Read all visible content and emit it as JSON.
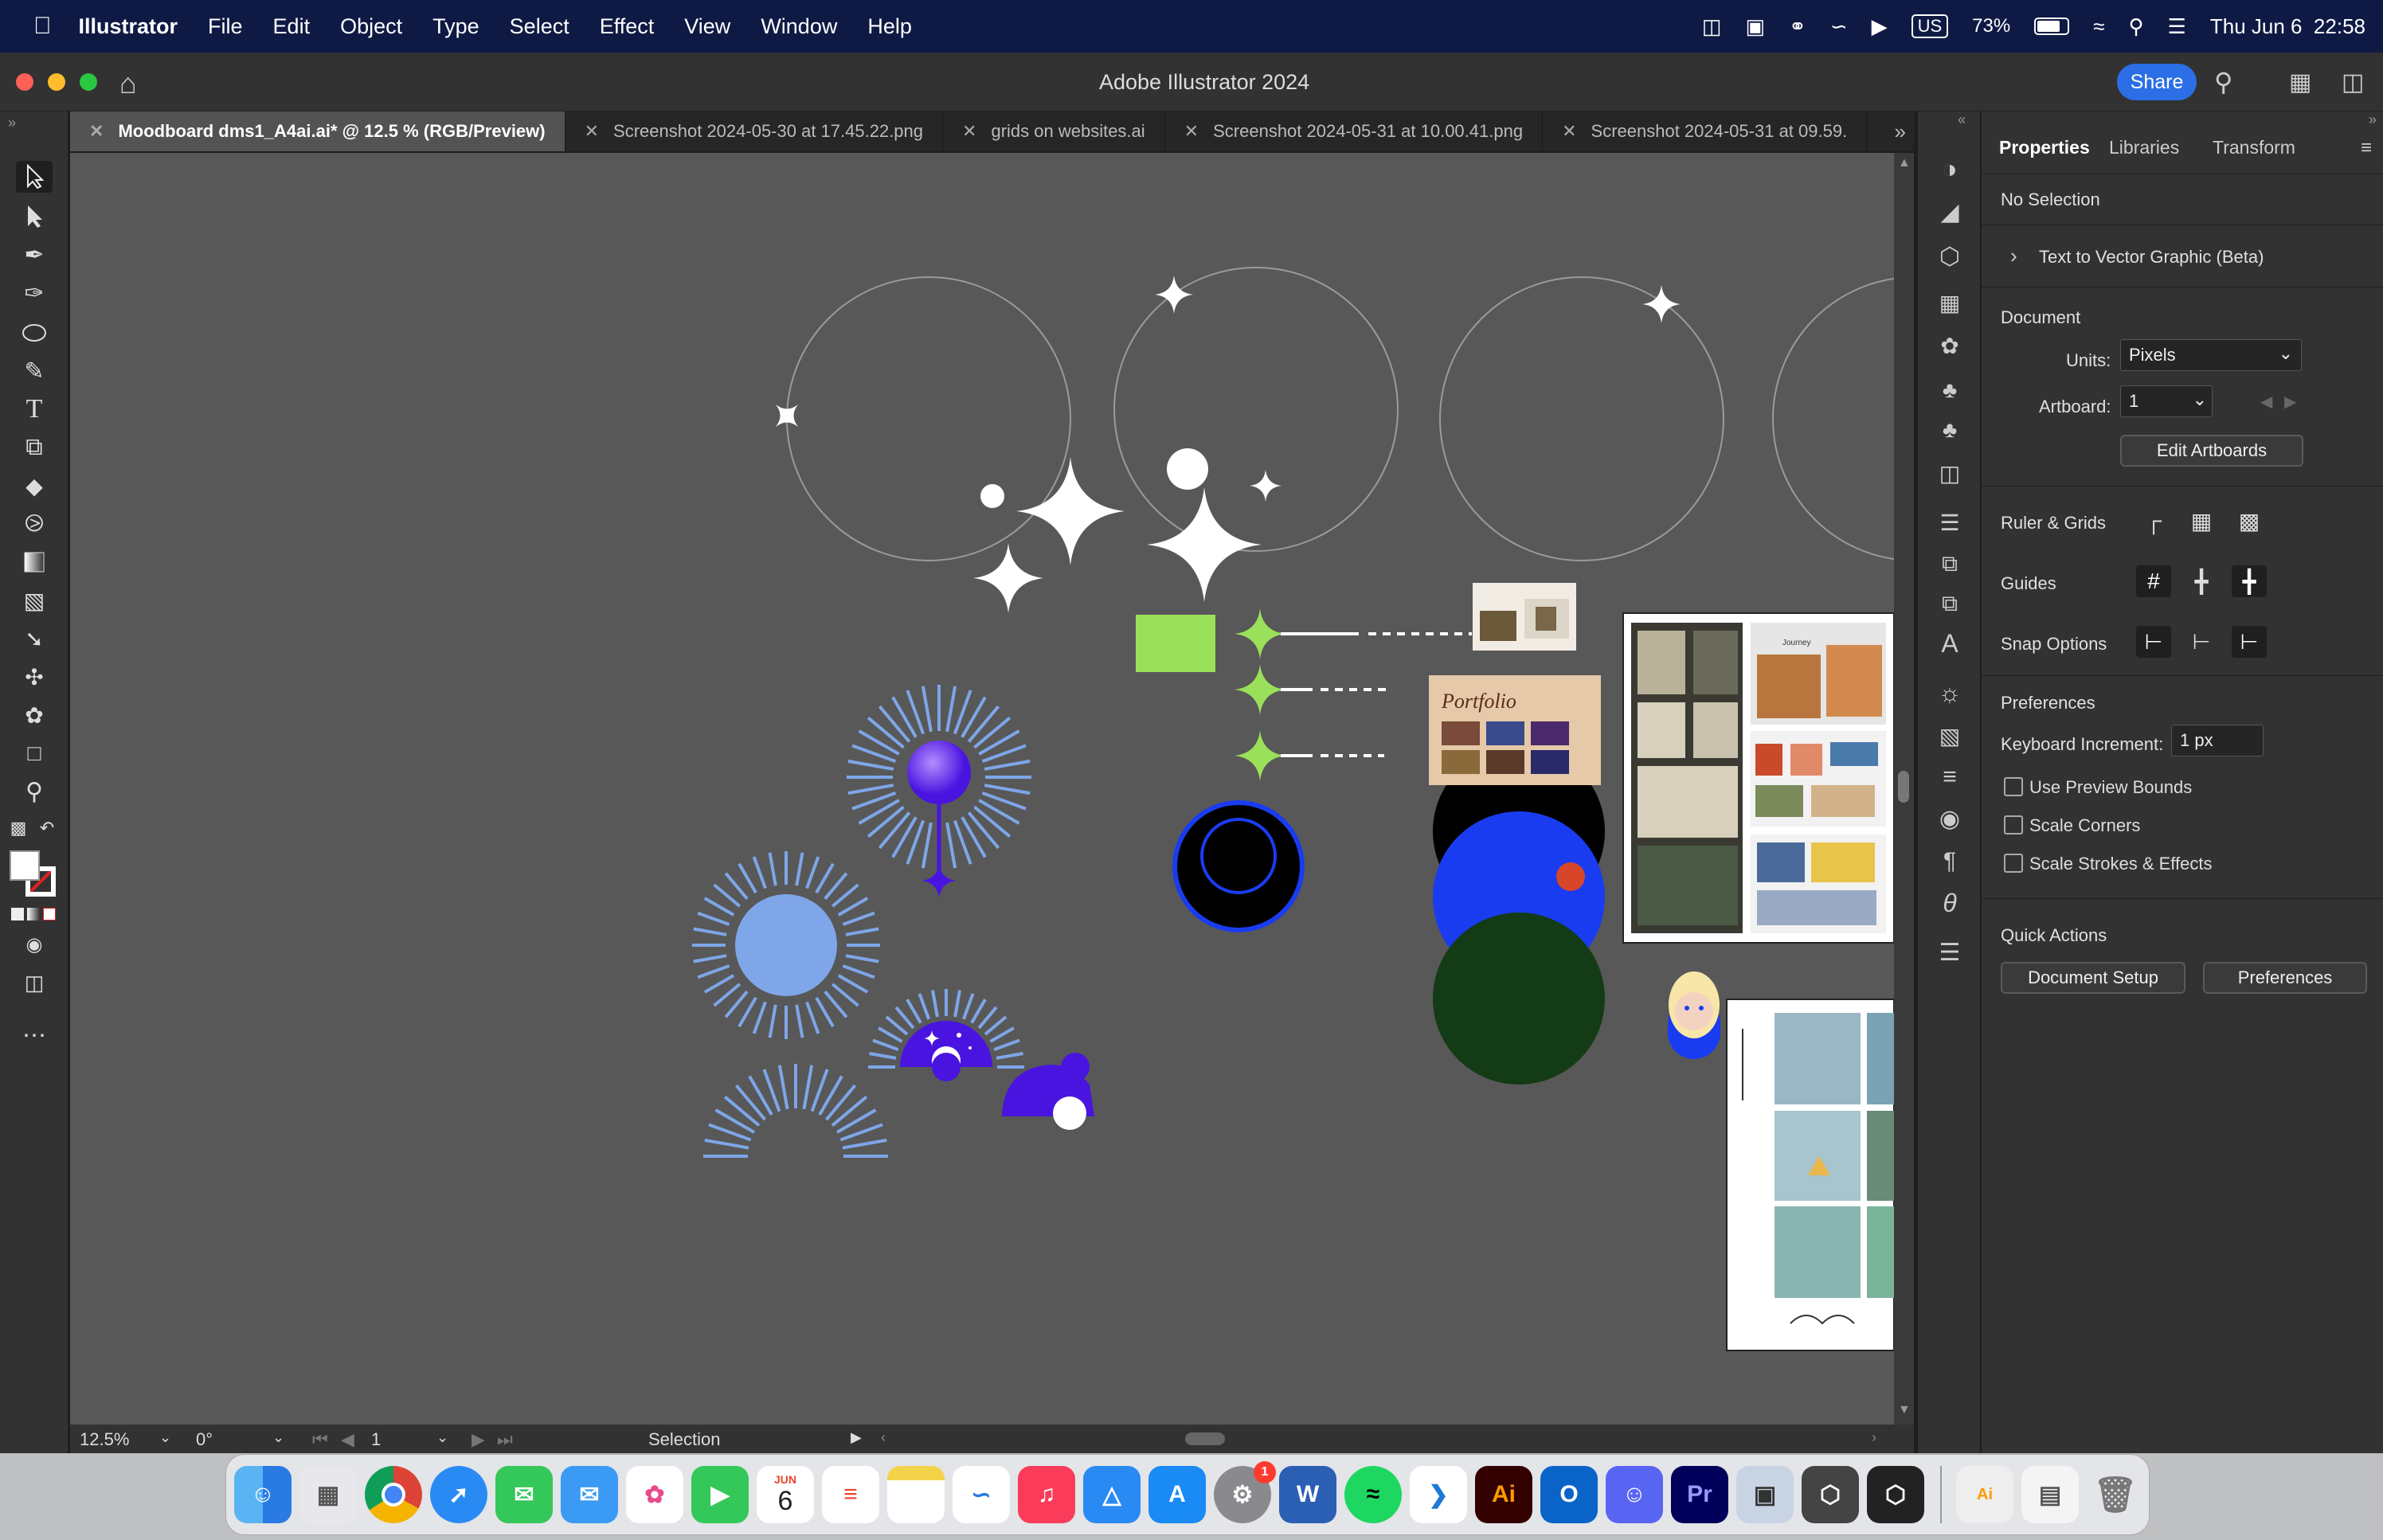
{
  "menubar": {
    "app_name": "Illustrator",
    "items": [
      "File",
      "Edit",
      "Object",
      "Type",
      "Select",
      "Effect",
      "View",
      "Window",
      "Help"
    ],
    "keyboard": "US",
    "battery": "73%",
    "datetime": "Thu Jun 6  22:58"
  },
  "window": {
    "title": "Adobe Illustrator 2024",
    "share_label": "Share"
  },
  "tabs": [
    {
      "label": "Moodboard dms1_A4ai.ai* @ 12.5 % (RGB/Preview)",
      "active": true
    },
    {
      "label": "Screenshot 2024-05-30 at 17.45.22.png"
    },
    {
      "label": "grids on websites.ai"
    },
    {
      "label": "Screenshot 2024-05-31 at 10.00.41.png"
    },
    {
      "label": "Screenshot 2024-05-31 at 09.59."
    }
  ],
  "status": {
    "zoom": "12.5%",
    "rotate": "0°",
    "artboard": "1",
    "tool": "Selection"
  },
  "panel": {
    "tabs": [
      "Properties",
      "Libraries",
      "Transform"
    ],
    "no_selection": "No Selection",
    "text_to_vector": "Text to Vector Graphic (Beta)",
    "document": "Document",
    "units_label": "Units:",
    "units_value": "Pixels",
    "artboard_label": "Artboard:",
    "artboard_value": "1",
    "edit_artboards": "Edit Artboards",
    "ruler_grids": "Ruler & Grids",
    "guides": "Guides",
    "snap_options": "Snap Options",
    "preferences": "Preferences",
    "keyboard_increment_label": "Keyboard Increment:",
    "keyboard_increment_value": "1 px",
    "use_preview_bounds": "Use Preview Bounds",
    "scale_corners": "Scale Corners",
    "scale_strokes": "Scale Strokes & Effects",
    "quick_actions": "Quick Actions",
    "document_setup": "Document Setup",
    "preferences_btn": "Preferences"
  },
  "canvas": {
    "portfolio_text": "Portfolio",
    "journey_text": "Journey"
  },
  "dock": {
    "calendar_month": "JUN",
    "calendar_day": "6",
    "badge": "1",
    "ai_label": "Ai",
    "pr_label": "Pr",
    "word_label": "W",
    "outlook_label": "O"
  },
  "colors": {
    "accent": "#2b6ee6",
    "purple": "#4a14e0",
    "green": "#9be05a",
    "blue": "#1a3cf0"
  }
}
